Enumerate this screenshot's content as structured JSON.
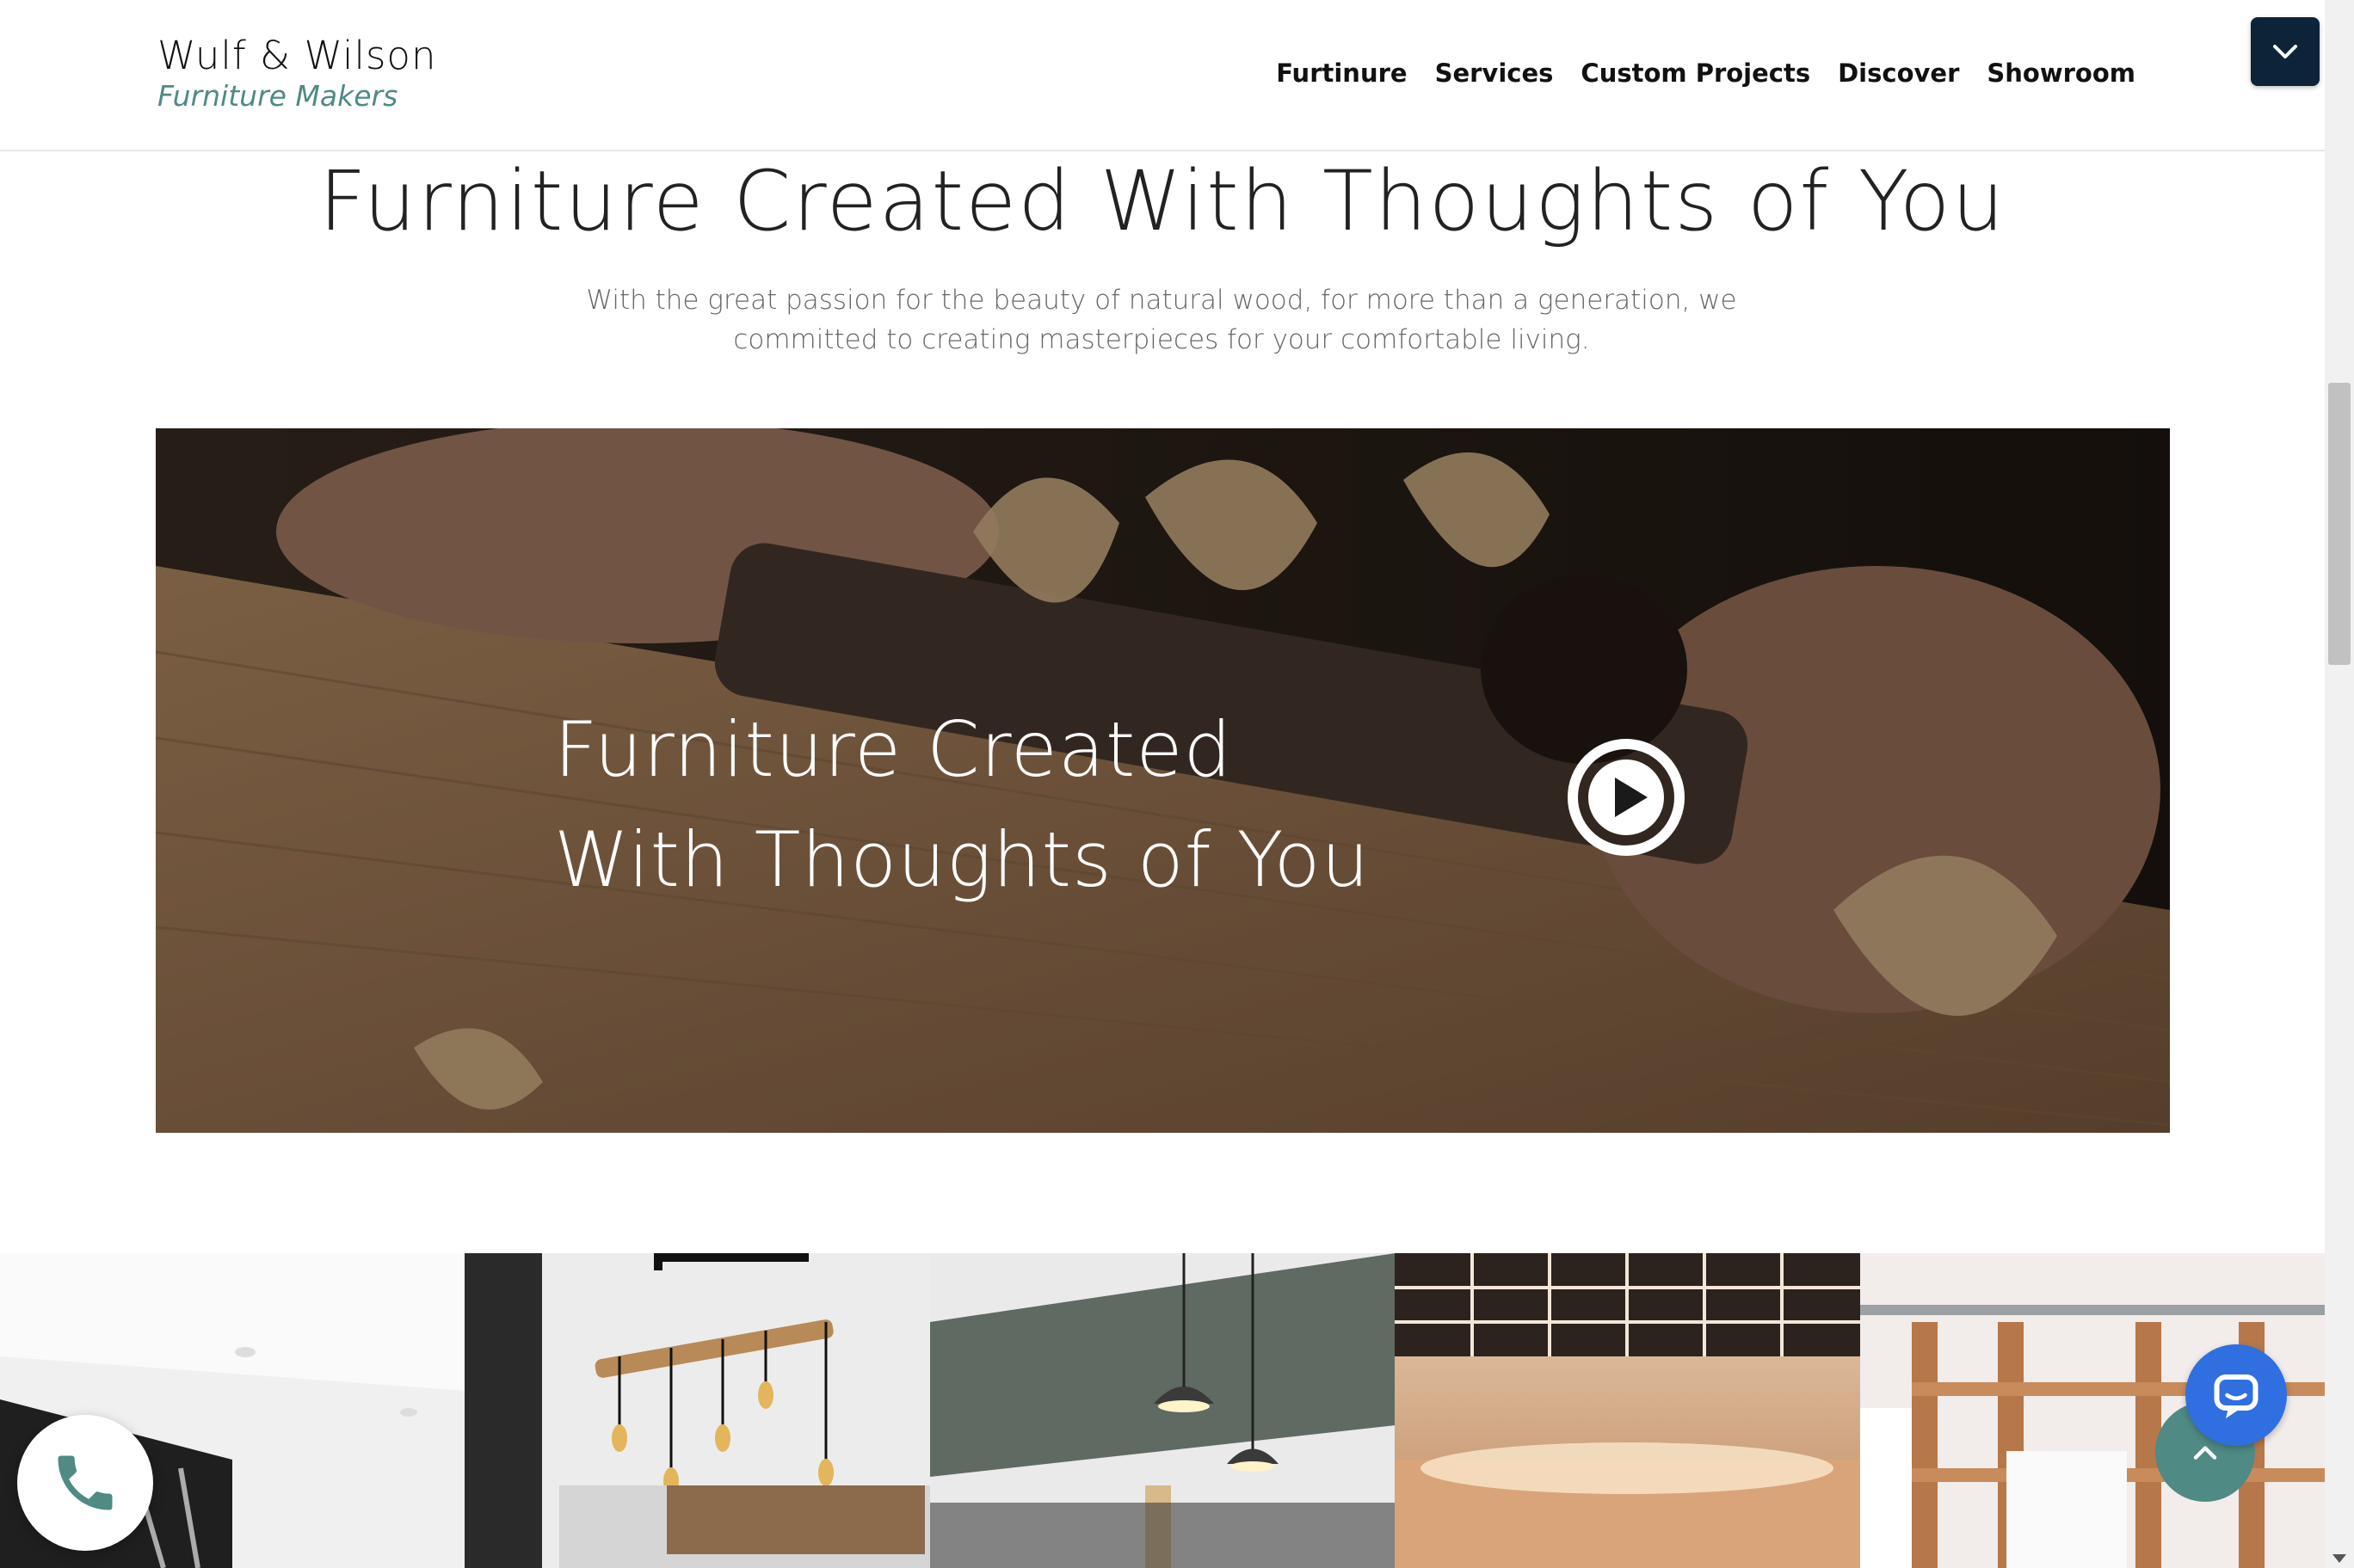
{
  "brand": {
    "name": "Wulf & Wilson",
    "tagline": "Furniture Makers"
  },
  "nav": {
    "items": [
      "Furtinure",
      "Services",
      "Custom Projects",
      "Discover",
      "Showroom"
    ]
  },
  "intro": {
    "title": "Furniture Created With Thoughts of You",
    "text": "With the great passion for the beauty of natural wood, for more than a generation, we committed to creating masterpieces for your comfortable living."
  },
  "video": {
    "title_line1": "Furniture Created",
    "title_line2": "With Thoughts of You"
  },
  "icons": {
    "menu": "chevron-down-icon",
    "play": "play-icon",
    "call": "phone-icon",
    "chat": "chat-icon",
    "back_to_top": "chevron-up-icon"
  },
  "colors": {
    "accent": "#4f8a84",
    "nav_dark": "#0d2438",
    "chat": "#2f6fe0"
  }
}
